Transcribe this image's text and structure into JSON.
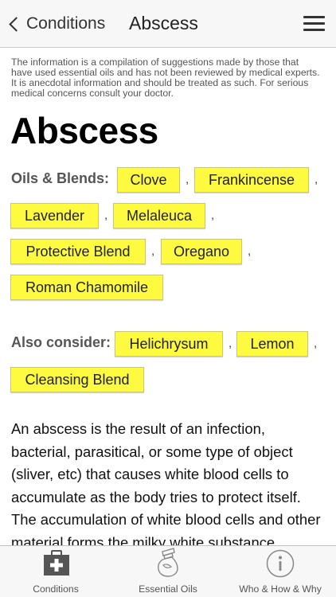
{
  "nav": {
    "back_label": "Conditions",
    "title": "Abscess"
  },
  "disclaimer": "The information is a compilation of suggestions made by those that have used essential oils and has not been reviewed by medical experts. It is anecdotal information and should be treated as such. For serious medical concerns consult your doctor.",
  "heading": "Abscess",
  "oils": {
    "label": "Oils & Blends:",
    "items": [
      "Clove",
      "Frankincense",
      "Lavender",
      "Melaleuca",
      "Protective Blend",
      "Oregano",
      "Roman Chamomile"
    ]
  },
  "consider": {
    "label": "Also consider:",
    "items": [
      "Helichrysum",
      "Lemon",
      "Cleansing Blend"
    ]
  },
  "separator": ",",
  "description": "An abscess is the result of an infection, bacterial, parasitical, or some type of object (sliver, etc) that causes white blood cells to accumulate as the body tries to protect itself. The accumulation of white blood cells and other material forms the milky white substance",
  "tabs": {
    "conditions": "Conditions",
    "essential_oils": "Essential Oils",
    "who_how_why": "Who & How & Why"
  },
  "icons": {
    "back": "chevron-left-icon",
    "menu": "hamburger-menu-icon",
    "conditions": "medical-kit-icon",
    "essential_oils": "oil-bottle-icon",
    "who_how_why": "info-icon"
  },
  "colors": {
    "chip_background": "#fdfa3f",
    "active_tab_icon": "#555555"
  }
}
